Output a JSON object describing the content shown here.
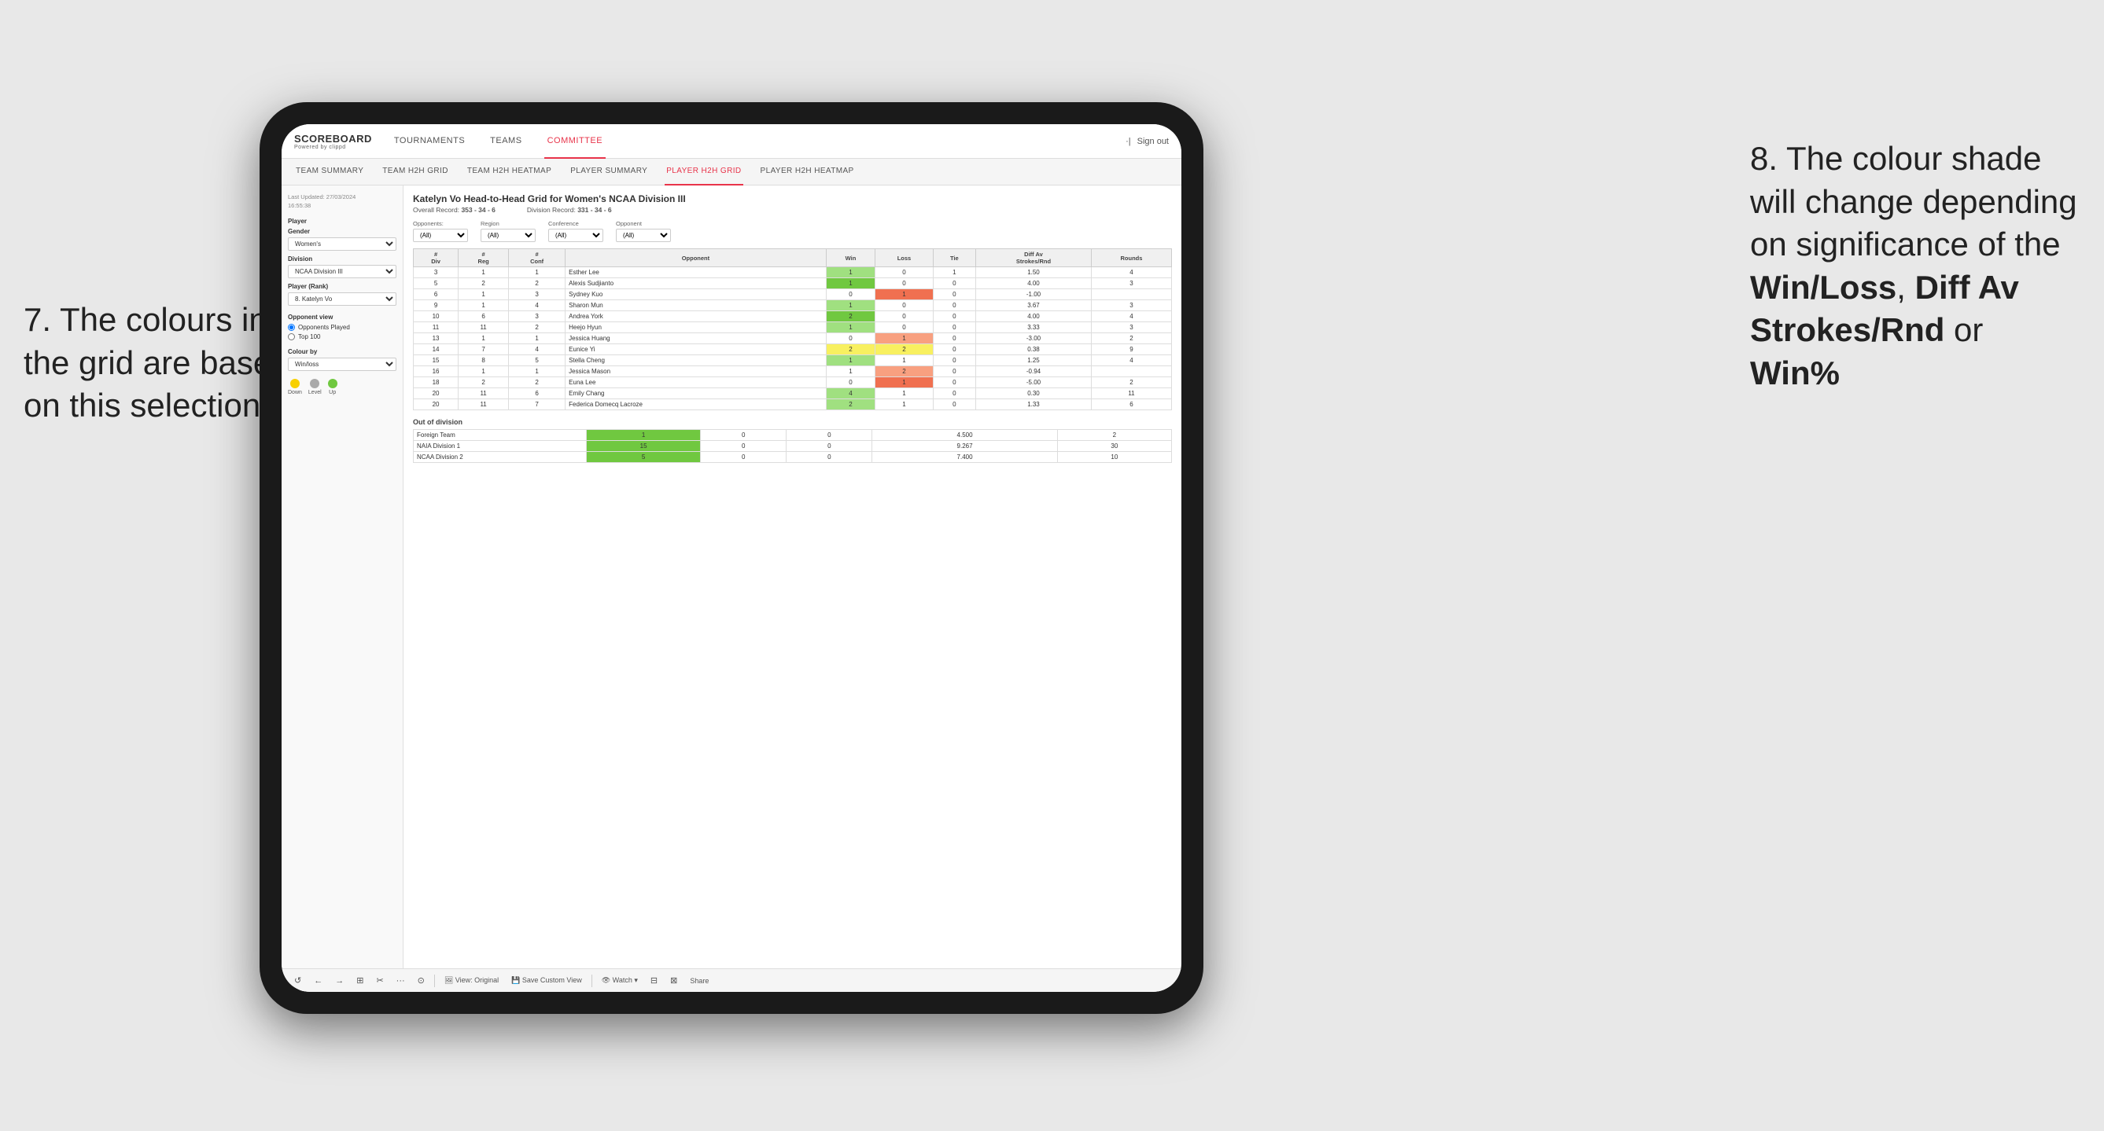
{
  "page": {
    "background": "#e8e8e8"
  },
  "annotation_left": {
    "line1": "7. The colours in",
    "line2": "the grid are based",
    "line3": "on this selection"
  },
  "annotation_right": {
    "intro": "8. The colour shade will change depending on significance of the ",
    "bold1": "Win/Loss",
    "sep1": ", ",
    "bold2": "Diff Av Strokes/Rnd",
    "sep2": " or ",
    "bold3": "Win%"
  },
  "nav": {
    "logo": "SCOREBOARD",
    "logo_sub": "Powered by clippd",
    "items": [
      {
        "label": "TOURNAMENTS",
        "active": false
      },
      {
        "label": "TEAMS",
        "active": false
      },
      {
        "label": "COMMITTEE",
        "active": true
      }
    ],
    "sign_in": "Sign out"
  },
  "sub_nav": {
    "items": [
      {
        "label": "TEAM SUMMARY",
        "active": false
      },
      {
        "label": "TEAM H2H GRID",
        "active": false
      },
      {
        "label": "TEAM H2H HEATMAP",
        "active": false
      },
      {
        "label": "PLAYER SUMMARY",
        "active": false
      },
      {
        "label": "PLAYER H2H GRID",
        "active": true
      },
      {
        "label": "PLAYER H2H HEATMAP",
        "active": false
      }
    ]
  },
  "sidebar": {
    "last_updated_label": "Last Updated: 27/03/2024",
    "last_updated_time": "16:55:38",
    "player_section": {
      "label": "Player",
      "gender_label": "Gender",
      "gender_value": "Women's",
      "division_label": "Division",
      "division_value": "NCAA Division III",
      "player_rank_label": "Player (Rank)",
      "player_rank_value": "8. Katelyn Vo"
    },
    "opponent_view": {
      "label": "Opponent view",
      "options": [
        "Opponents Played",
        "Top 100"
      ],
      "selected": "Opponents Played"
    },
    "colour_by": {
      "label": "Colour by",
      "value": "Win/loss"
    },
    "legend": {
      "down_label": "Down",
      "level_label": "Level",
      "up_label": "Up"
    }
  },
  "grid": {
    "title": "Katelyn Vo Head-to-Head Grid for Women's NCAA Division III",
    "overall_record_label": "Overall Record:",
    "overall_record": "353 - 34 - 6",
    "division_record_label": "Division Record:",
    "division_record": "331 - 34 - 6",
    "filters": {
      "opponents_label": "Opponents:",
      "opponents_value": "(All)",
      "region_label": "Region",
      "region_value": "(All)",
      "conference_label": "Conference",
      "conference_value": "(All)",
      "opponent_label": "Opponent",
      "opponent_value": "(All)"
    },
    "columns": {
      "div": "#\nDiv",
      "reg": "#\nReg",
      "conf": "#\nConf",
      "opponent": "Opponent",
      "win": "Win",
      "loss": "Loss",
      "tie": "Tie",
      "diff_av": "Diff Av\nStrokes/Rnd",
      "rounds": "Rounds"
    },
    "rows": [
      {
        "div": 3,
        "reg": 1,
        "conf": 1,
        "opponent": "Esther Lee",
        "win": 1,
        "loss": 0,
        "tie": 1,
        "diff_av": 1.5,
        "rounds": 4,
        "color": "green-light"
      },
      {
        "div": 5,
        "reg": 2,
        "conf": 2,
        "opponent": "Alexis Sudjianto",
        "win": 1,
        "loss": 0,
        "tie": 0,
        "diff_av": 4.0,
        "rounds": 3,
        "color": "green-medium"
      },
      {
        "div": 6,
        "reg": 1,
        "conf": 3,
        "opponent": "Sydney Kuo",
        "win": 0,
        "loss": 1,
        "tie": 0,
        "diff_av": -1.0,
        "rounds": "",
        "color": "red-medium"
      },
      {
        "div": 9,
        "reg": 1,
        "conf": 4,
        "opponent": "Sharon Mun",
        "win": 1,
        "loss": 0,
        "tie": 0,
        "diff_av": 3.67,
        "rounds": 3,
        "color": "green-light"
      },
      {
        "div": 10,
        "reg": 6,
        "conf": 3,
        "opponent": "Andrea York",
        "win": 2,
        "loss": 0,
        "tie": 0,
        "diff_av": 4.0,
        "rounds": 4,
        "color": "green-medium"
      },
      {
        "div": 11,
        "reg": 11,
        "conf": 2,
        "opponent": "Heejo Hyun",
        "win": 1,
        "loss": 0,
        "tie": 0,
        "diff_av": 3.33,
        "rounds": 3,
        "color": "green-light"
      },
      {
        "div": 13,
        "reg": 1,
        "conf": 1,
        "opponent": "Jessica Huang",
        "win": 0,
        "loss": 1,
        "tie": 0,
        "diff_av": -3.0,
        "rounds": 2,
        "color": "red-medium"
      },
      {
        "div": 14,
        "reg": 7,
        "conf": 4,
        "opponent": "Eunice Yi",
        "win": 2,
        "loss": 2,
        "tie": 0,
        "diff_av": 0.38,
        "rounds": 9,
        "color": "yellow"
      },
      {
        "div": 15,
        "reg": 8,
        "conf": 5,
        "opponent": "Stella Cheng",
        "win": 1,
        "loss": 1,
        "tie": 0,
        "diff_av": 1.25,
        "rounds": 4,
        "color": "green-light"
      },
      {
        "div": 16,
        "reg": 1,
        "conf": 1,
        "opponent": "Jessica Mason",
        "win": 1,
        "loss": 2,
        "tie": 0,
        "diff_av": -0.94,
        "rounds": "",
        "color": "red-light"
      },
      {
        "div": 18,
        "reg": 2,
        "conf": 2,
        "opponent": "Euna Lee",
        "win": 0,
        "loss": 1,
        "tie": 0,
        "diff_av": -5.0,
        "rounds": 2,
        "color": "red-medium"
      },
      {
        "div": 20,
        "reg": 11,
        "conf": 6,
        "opponent": "Emily Chang",
        "win": 4,
        "loss": 1,
        "tie": 0,
        "diff_av": 0.3,
        "rounds": 11,
        "color": "green-light"
      },
      {
        "div": 20,
        "reg": 11,
        "conf": 7,
        "opponent": "Federica Domecq Lacroze",
        "win": 2,
        "loss": 1,
        "tie": 0,
        "diff_av": 1.33,
        "rounds": 6,
        "color": "green-light"
      }
    ],
    "out_of_division": {
      "title": "Out of division",
      "rows": [
        {
          "label": "Foreign Team",
          "win": 1,
          "loss": 0,
          "tie": 0,
          "diff_av": 4.5,
          "rounds": 2,
          "color": "green-medium"
        },
        {
          "label": "NAIA Division 1",
          "win": 15,
          "loss": 0,
          "tie": 0,
          "diff_av": 9.267,
          "rounds": 30,
          "color": "green-medium"
        },
        {
          "label": "NCAA Division 2",
          "win": 5,
          "loss": 0,
          "tie": 0,
          "diff_av": 7.4,
          "rounds": 10,
          "color": "green-medium"
        }
      ]
    }
  },
  "toolbar": {
    "buttons": [
      "↺",
      "←",
      "→",
      "⊞",
      "✂",
      "⋯",
      "⊙",
      "|",
      "View: Original",
      "Save Custom View",
      "Watch ▾",
      "⊟",
      "⊠",
      "Share"
    ]
  }
}
